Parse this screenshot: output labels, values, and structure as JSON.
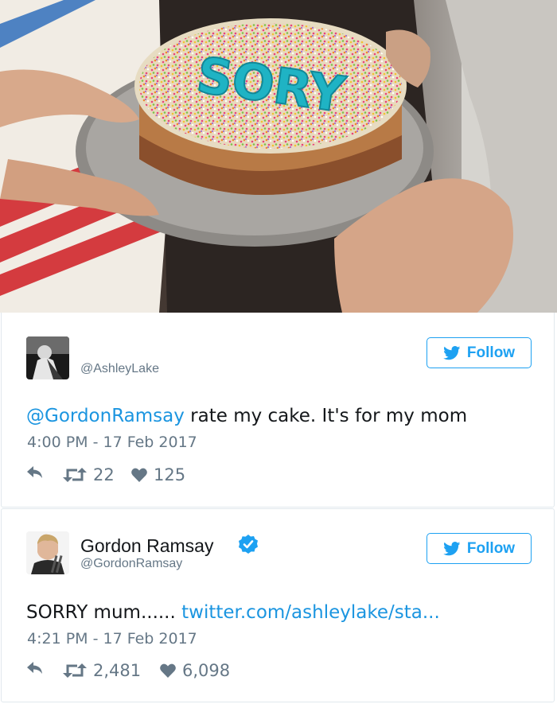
{
  "photo": {
    "cake_text": "SORY",
    "icon": "cake-photo"
  },
  "tweets": [
    {
      "display_name": "",
      "handle": "@AshleyLake",
      "verified": false,
      "follow_label": "Follow",
      "mention": "@GordonRamsay",
      "text": " rate my cake. It's for my mom",
      "timestamp": "4:00 PM - 17 Feb 2017",
      "retweets": "22",
      "likes": "125"
    },
    {
      "display_name": "Gordon Ramsay",
      "handle": "@GordonRamsay",
      "verified": true,
      "follow_label": "Follow",
      "text": "SORRY mum...... ",
      "link": "twitter.com/ashleylake/sta...",
      "timestamp": "4:21 PM - 17 Feb 2017",
      "retweets": "2,481",
      "likes": "6,098"
    }
  ],
  "colors": {
    "twitter_blue": "#1da1f2",
    "link_blue": "#1b95e0",
    "meta_gray": "#657786",
    "icing_teal": "#1fb3c4"
  }
}
